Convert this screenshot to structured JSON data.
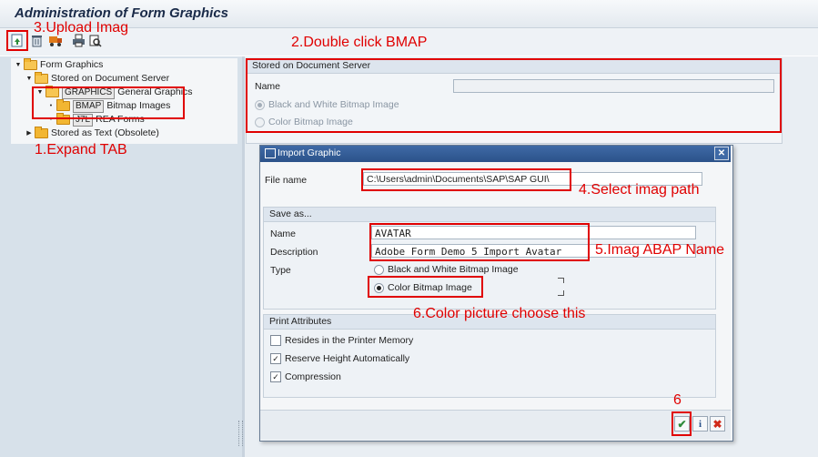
{
  "window": {
    "title": "Administration of Form Graphics"
  },
  "toolbar": {
    "icons": [
      "upload-icon",
      "trash-icon",
      "transport-icon",
      "print-icon",
      "print-preview-icon"
    ]
  },
  "tree": {
    "root": "Form Graphics",
    "stored_doc_server": "Stored on Document Server",
    "graphics_key": "GRAPHICS",
    "graphics_label": "General Graphics",
    "bmap_key": "BMAP",
    "bmap_label": "Bitmap Images",
    "j7l_key": "J7L",
    "j7l_label": "REA Forms",
    "stored_text": "Stored as Text (Obsolete)"
  },
  "doc_server": {
    "header": "Stored on Document Server",
    "name_label": "Name",
    "name_value": "",
    "option_bw": "Black and White Bitmap Image",
    "option_color": "Color Bitmap Image"
  },
  "dialog": {
    "title": "Import Graphic",
    "file_label": "File name",
    "file_value": "C:\\Users\\admin\\Documents\\SAP\\SAP GUI\\",
    "save_as": {
      "header": "Save as...",
      "name_label": "Name",
      "name_value": "AVATAR",
      "desc_label": "Description",
      "desc_value": "Adobe Form Demo 5 Import Avatar",
      "type_label": "Type",
      "type_bw": "Black and White Bitmap Image",
      "type_color": "Color Bitmap Image",
      "selected": "Color Bitmap Image"
    },
    "print_attrs": {
      "header": "Print Attributes",
      "resides": "Resides in the Printer Memory",
      "resides_checked": false,
      "reserve": "Reserve Height Automatically",
      "reserve_checked": true,
      "compression": "Compression",
      "compression_checked": true
    }
  },
  "annotations": {
    "a1": "1.Expand TAB",
    "a2": "2.Double click BMAP",
    "a3": "3.Upload Imag",
    "a4": "4.Select imag path",
    "a5": "5.Imag ABAP Name",
    "a6": "6.Color picture choose this",
    "a7": "6"
  },
  "colors": {
    "annotation": "#e00000",
    "titlebar": "#2b528a",
    "folder": "#f2b632"
  }
}
